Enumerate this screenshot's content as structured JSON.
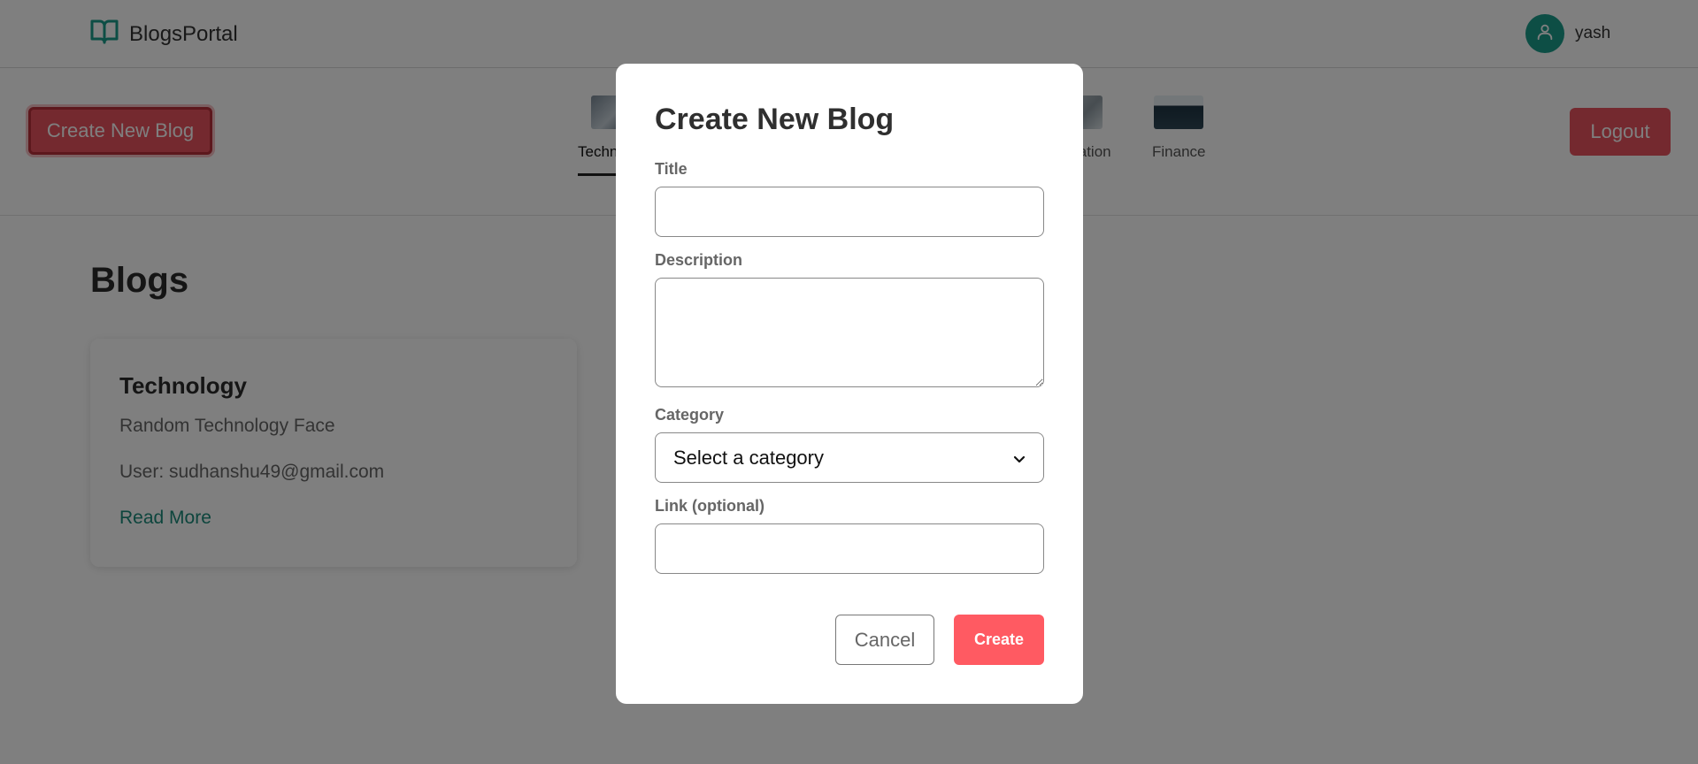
{
  "header": {
    "brand": "BlogsPortal",
    "user_name": "yash"
  },
  "subnav": {
    "create_label": "Create New Blog",
    "logout_label": "Logout",
    "categories": [
      {
        "label": "Technology",
        "active": true
      },
      {
        "label": "Education",
        "active": false
      },
      {
        "label": "Finance",
        "active": false
      }
    ]
  },
  "main": {
    "title": "Blogs",
    "cards": [
      {
        "title": "Technology",
        "description": "Random Technology Face",
        "user": "User: sudhanshu49@gmail.com",
        "link": "Read More"
      }
    ]
  },
  "modal": {
    "title": "Create New Blog",
    "fields": {
      "title_label": "Title",
      "title_value": "",
      "description_label": "Description",
      "description_value": "",
      "category_label": "Category",
      "category_selected": "Select a category",
      "link_label": "Link (optional)",
      "link_value": ""
    },
    "cancel_label": "Cancel",
    "submit_label": "Create"
  },
  "colors": {
    "accent": "#e9535f",
    "brand_teal": "#1a9c8b",
    "link_teal": "#1a8a7a",
    "overlay": "rgba(0,0,0,0.5)"
  }
}
